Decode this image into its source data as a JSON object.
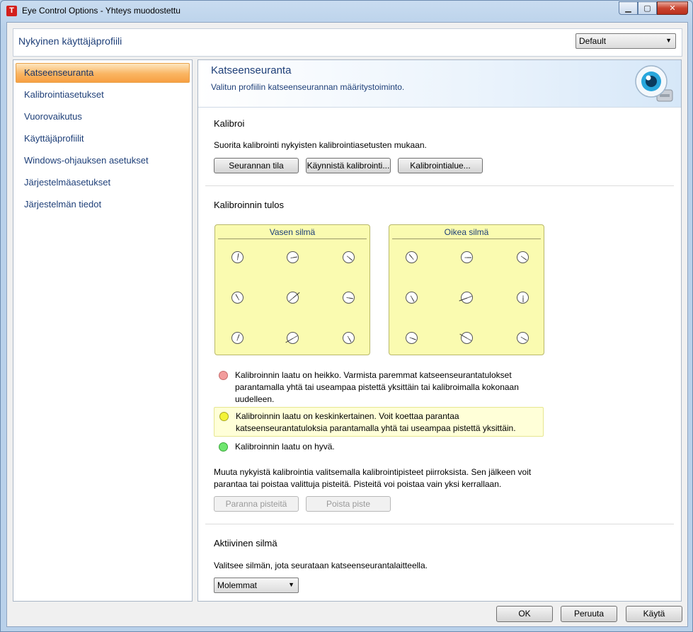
{
  "window": {
    "title": "Eye Control Options - Yhteys muodostettu",
    "app_icon_letter": "T",
    "controls": {
      "minimize": "▁",
      "maximize": "▢",
      "close": "✕"
    }
  },
  "profile": {
    "label": "Nykyinen käyttäjäprofiili",
    "selected": "Default",
    "arrow": "▼"
  },
  "sidebar": {
    "items": [
      {
        "label": "Katseenseuranta",
        "active": true
      },
      {
        "label": "Kalibrointiasetukset"
      },
      {
        "label": "Vuorovaikutus"
      },
      {
        "label": "Käyttäjäprofiilit"
      },
      {
        "label": "Windows-ohjauksen asetukset"
      },
      {
        "label": "Järjestelmäasetukset"
      },
      {
        "label": "Järjestelmän tiedot"
      }
    ]
  },
  "main": {
    "title": "Katseenseuranta",
    "subtitle": "Valitun profiilin katseenseurannan määritystoiminto.",
    "calibrate": {
      "title": "Kalibroi",
      "description": "Suorita kalibrointi nykyisten kalibrointiasetusten mukaan.",
      "btn_status": "Seurannan tila",
      "btn_start": "Käynnistä kalibrointi...",
      "btn_area": "Kalibrointialue..."
    },
    "result": {
      "title": "Kalibroinnin tulos",
      "left_eye": "Vasen silmä",
      "right_eye": "Oikea silmä"
    },
    "legend": {
      "poor": "Kalibroinnin laatu on heikko. Varmista paremmat katseenseurantatulokset parantamalla yhtä tai useampaa pistettä yksittäin tai kalibroimalla kokonaan uudelleen.",
      "medium": "Kalibroinnin laatu on keskinkertainen. Voit koettaa parantaa katseenseurantatuloksia parantamalla yhtä tai useampaa pistettä yksittäin.",
      "good": "Kalibroinnin laatu on hyvä.",
      "colors": {
        "poor": "#f29c9c",
        "medium": "#f3f336",
        "good": "#6ee66e"
      }
    },
    "edit_help": "Muuta nykyistä kalibrointia valitsemalla kalibrointipisteet piirroksista. Sen jälkeen voit parantaa tai poistaa valittuja pisteitä. Pisteitä voi poistaa vain yksi kerrallaan.",
    "btn_improve": "Paranna pisteitä",
    "btn_remove": "Poista piste",
    "active_eye": {
      "title": "Aktiivinen silmä",
      "description": "Valitsee silmän, jota seurataan katseenseurantalaitteella.",
      "selected": "Molemmat",
      "arrow": "▼"
    }
  },
  "footer": {
    "ok": "OK",
    "cancel": "Peruuta",
    "apply": "Käytä"
  }
}
